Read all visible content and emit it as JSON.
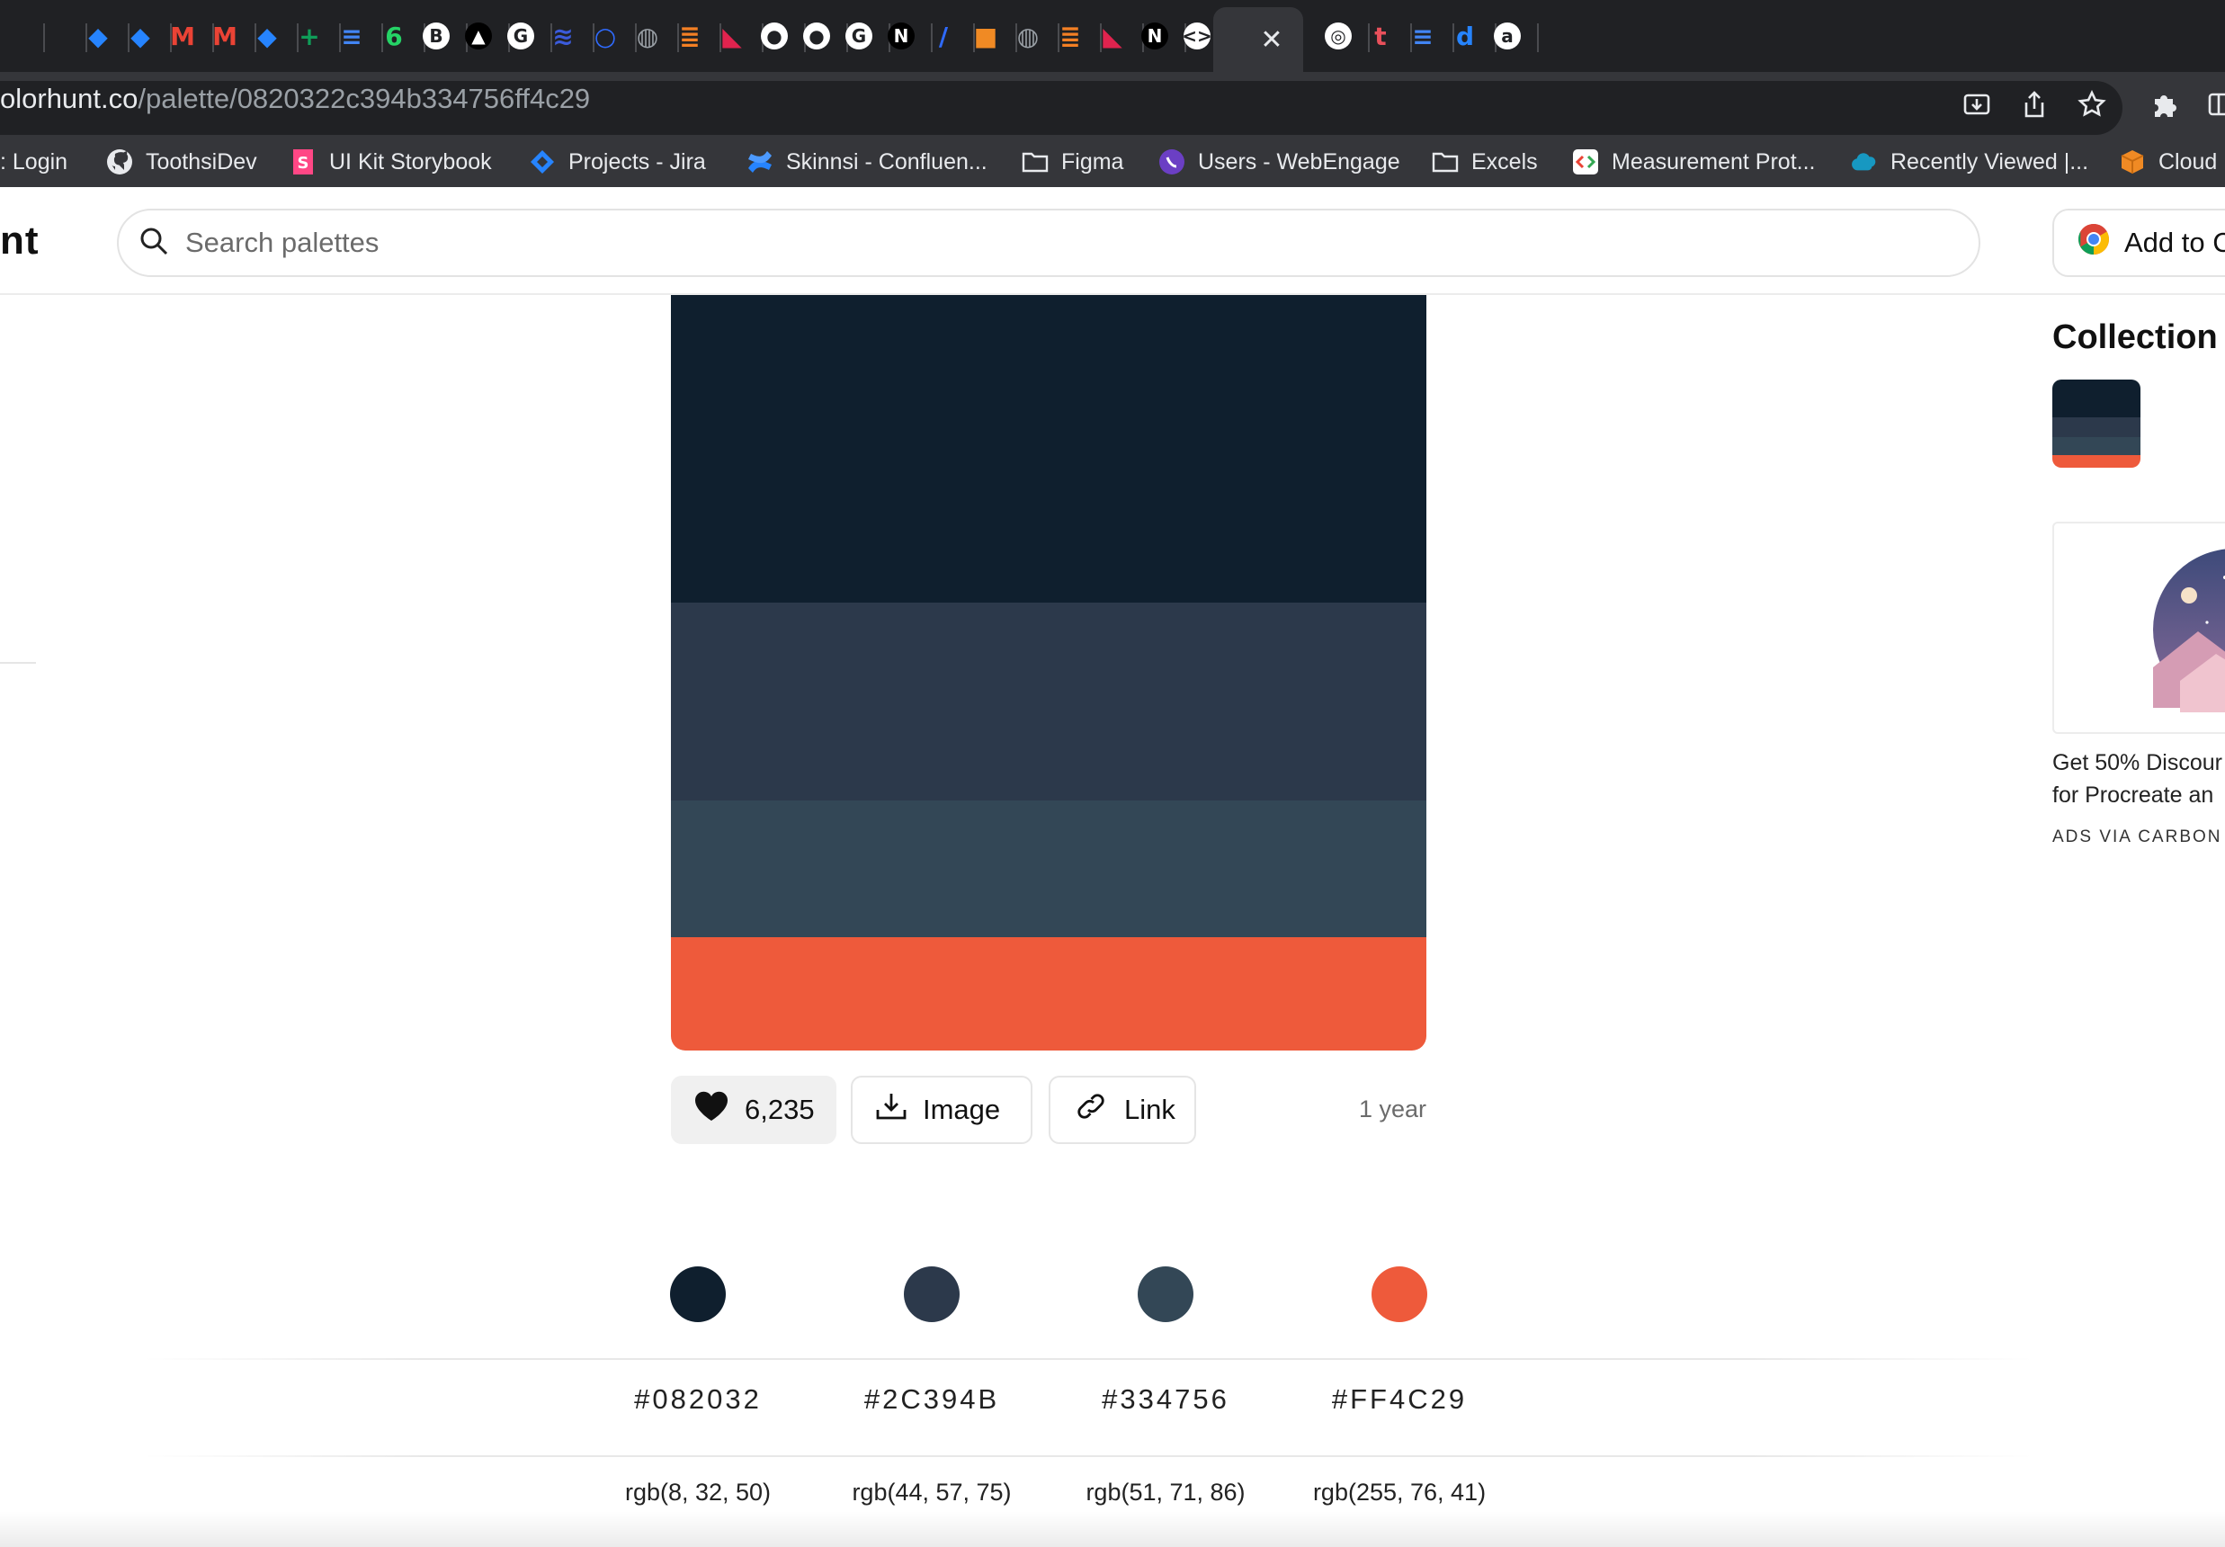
{
  "browser": {
    "tabs": [
      {
        "icon": "doc-icon",
        "color": "#4285f4",
        "glyph": ""
      },
      {
        "icon": "google-meet-icon",
        "color": "#00897b",
        "glyph": ""
      },
      {
        "icon": "jira-icon",
        "color": "#2684ff",
        "glyph": "◆"
      },
      {
        "icon": "jira-icon",
        "color": "#2684ff",
        "glyph": "◆"
      },
      {
        "icon": "gmail-icon",
        "color": "#ea4335",
        "glyph": "M"
      },
      {
        "icon": "gmail-icon",
        "color": "#ea4335",
        "glyph": "M"
      },
      {
        "icon": "jira-icon",
        "color": "#2684ff",
        "glyph": "◆"
      },
      {
        "icon": "google-sheets-icon",
        "color": "#0f9d58",
        "glyph": "+"
      },
      {
        "icon": "google-docs-icon",
        "color": "#4285f4",
        "glyph": "≡"
      },
      {
        "icon": "whatsapp-icon",
        "color": "#25d366",
        "glyph": "6"
      },
      {
        "icon": "bold-b-icon",
        "color": "#ffffff",
        "glyph": "B"
      },
      {
        "icon": "vercel-icon",
        "color": "#000000",
        "glyph": "▲"
      },
      {
        "icon": "google-icon",
        "color": "#ffffff",
        "glyph": "G"
      },
      {
        "icon": "layers-icon",
        "color": "#3b5bdb",
        "glyph": "≋"
      },
      {
        "icon": "ring-icon",
        "color": "#2f6bff",
        "glyph": "○"
      },
      {
        "icon": "globe-icon",
        "color": "#9aa0a6",
        "glyph": "◍"
      },
      {
        "icon": "stackoverflow-icon",
        "color": "#f48024",
        "glyph": "≣"
      },
      {
        "icon": "nestjs-icon",
        "color": "#e0234e",
        "glyph": "◣"
      },
      {
        "icon": "github-icon",
        "color": "#ffffff",
        "glyph": "●"
      },
      {
        "icon": "github-icon",
        "color": "#ffffff",
        "glyph": "●"
      },
      {
        "icon": "google-icon",
        "color": "#ffffff",
        "glyph": "G"
      },
      {
        "icon": "notion-n-icon",
        "color": "#000000",
        "glyph": "N"
      },
      {
        "icon": "slash-icon",
        "color": "#2f6bff",
        "glyph": "/"
      },
      {
        "icon": "box-icon",
        "color": "#f08a24",
        "glyph": "■"
      },
      {
        "icon": "globe-icon",
        "color": "#9aa0a6",
        "glyph": "◍"
      },
      {
        "icon": "stackoverflow-icon",
        "color": "#f48024",
        "glyph": "≣"
      },
      {
        "icon": "nestjs-icon",
        "color": "#e0234e",
        "glyph": "◣"
      },
      {
        "icon": "notion-n-icon",
        "color": "#000000",
        "glyph": "N"
      },
      {
        "icon": "code-icon",
        "color": "#ffffff",
        "glyph": "<>"
      }
    ],
    "active_tab_close": "✕",
    "tabs_after": [
      {
        "icon": "chrome-icon",
        "color": "#ffffff",
        "glyph": "◎"
      },
      {
        "icon": "t-icon",
        "color": "#e8505b",
        "glyph": "t"
      },
      {
        "icon": "google-docs-icon",
        "color": "#4285f4",
        "glyph": "≡"
      },
      {
        "icon": "d-icon",
        "color": "#2684ff",
        "glyph": "d"
      },
      {
        "icon": "amazon-icon",
        "color": "#ffffff",
        "glyph": "a"
      }
    ],
    "url_host": "olorhunt.co",
    "url_path": "/palette/0820322c394b334756ff4c29",
    "bookmarks": [
      {
        "label": ": Login",
        "icon": ""
      },
      {
        "label": "ToothsiDev",
        "icon": "github-icon"
      },
      {
        "label": "UI Kit Storybook",
        "icon": "storybook-icon"
      },
      {
        "label": "Projects - Jira",
        "icon": "jira-icon"
      },
      {
        "label": "Skinnsi - Confluen...",
        "icon": "confluence-icon"
      },
      {
        "label": "Figma",
        "icon": "folder-icon"
      },
      {
        "label": "Users - WebEngage",
        "icon": "webengage-icon"
      },
      {
        "label": "Excels",
        "icon": "folder-icon"
      },
      {
        "label": "Measurement Prot...",
        "icon": "code-icon"
      },
      {
        "label": "Recently Viewed |...",
        "icon": "salesforce-cloud-icon"
      },
      {
        "label": "Cloud",
        "icon": "box-icon"
      }
    ]
  },
  "site": {
    "logo_fragment": "nt",
    "search_placeholder": "Search palettes",
    "add_button_label": "Add to C"
  },
  "palette": {
    "colors": [
      {
        "hex": "#082032",
        "display": "#082032",
        "rgb": "rgb(8, 32, 50)",
        "swatch": "#0f1f2e"
      },
      {
        "hex": "#2C394B",
        "display": "#2C394B",
        "rgb": "rgb(44, 57, 75)",
        "swatch": "#2c394b"
      },
      {
        "hex": "#334756",
        "display": "#334756",
        "rgb": "rgb(51, 71, 86)",
        "swatch": "#334756"
      },
      {
        "hex": "#FF4C29",
        "display": "#FF4C29",
        "rgb": "rgb(255, 76, 41)",
        "swatch": "#ee5a3b"
      }
    ],
    "likes": "6,235",
    "image_label": "Image",
    "link_label": "Link",
    "age": "1 year"
  },
  "sidebar": {
    "title": "Collection",
    "ad_line1": "Get 50% Discour",
    "ad_line2": "for Procreate an",
    "ad_via": "ADS VIA CARBON"
  }
}
